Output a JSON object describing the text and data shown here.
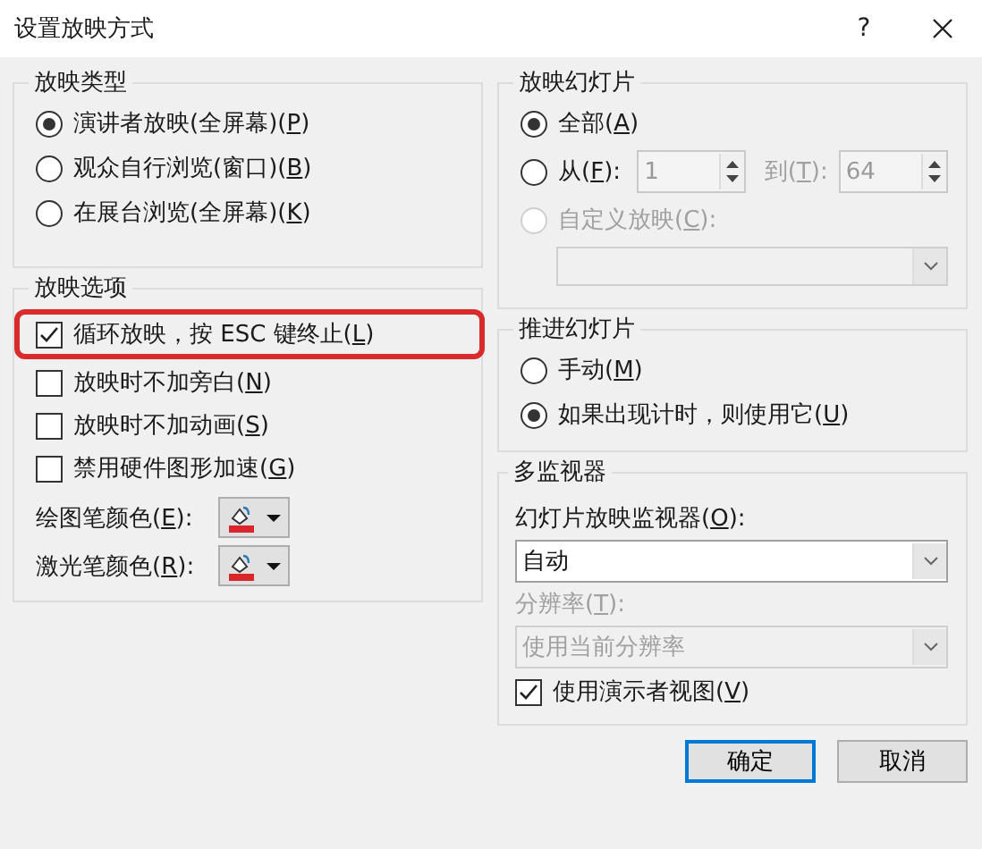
{
  "window": {
    "title": "设置放映方式",
    "help": "?"
  },
  "show_type": {
    "title": "放映类型",
    "options": [
      {
        "label": "演讲者放映(全屏幕)(P)",
        "selected": true
      },
      {
        "label": "观众自行浏览(窗口)(B)",
        "selected": false
      },
      {
        "label": "在展台浏览(全屏幕)(K)",
        "selected": false
      }
    ]
  },
  "show_options": {
    "title": "放映选项",
    "checks": [
      {
        "label": "循环放映，按 ESC 键终止(L)",
        "checked": true,
        "highlighted": true
      },
      {
        "label": "放映时不加旁白(N)",
        "checked": false,
        "highlighted": false
      },
      {
        "label": "放映时不加动画(S)",
        "checked": false,
        "highlighted": false
      },
      {
        "label": "禁用硬件图形加速(G)",
        "checked": false,
        "highlighted": false
      }
    ],
    "pens": [
      {
        "label": "绘图笔颜色(E):",
        "color": "#d9262b"
      },
      {
        "label": "激光笔颜色(R):",
        "color": "#d9262b"
      }
    ]
  },
  "show_slides": {
    "title": "放映幻灯片",
    "options": [
      {
        "kind": "plain",
        "label": "全部(A)",
        "selected": true
      },
      {
        "kind": "range",
        "label": "从(F):",
        "selected": false,
        "from": "1",
        "to_label": "到(T):",
        "to": "64"
      },
      {
        "kind": "custom",
        "label": "自定义放映(C):",
        "selected": false,
        "disabled": true
      }
    ]
  },
  "advance": {
    "title": "推进幻灯片",
    "options": [
      {
        "label": "手动(M)",
        "selected": false
      },
      {
        "label": "如果出现计时，则使用它(U)",
        "selected": true
      }
    ]
  },
  "monitors": {
    "title": "多监视器",
    "monitor_label": "幻灯片放映监视器(O):",
    "monitor_value": "自动",
    "resolution_label": "分辨率(T):",
    "resolution_value": "使用当前分辨率",
    "resolution_disabled": true,
    "presenter_view": {
      "label": "使用演示者视图(V)",
      "checked": true
    }
  },
  "buttons": [
    {
      "label": "确定",
      "default": true
    },
    {
      "label": "取消",
      "default": false
    }
  ]
}
